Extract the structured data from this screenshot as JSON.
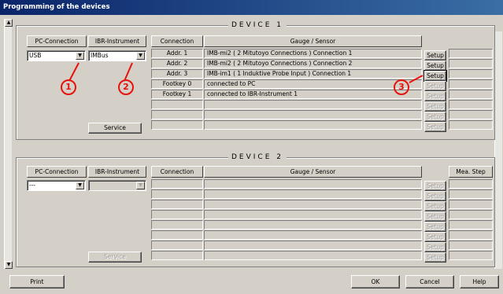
{
  "window": {
    "title": "Programming of the devices"
  },
  "device1": {
    "title": "DEVICE 1",
    "pc_connection_header": "PC-Connection",
    "ibr_instrument_header": "IBR-Instrument",
    "connection_header": "Connection",
    "gauge_header": "Gauge / Sensor",
    "pc_connection_value": "USB",
    "ibr_instrument_value": "IMBus",
    "service_label": "Service",
    "rows": [
      {
        "connection": "Addr. 1",
        "gauge": "IMB-mi2 ( 2 Mitutoyo Connections ) Connection 1",
        "setup": "Setup",
        "enabled": true
      },
      {
        "connection": "Addr. 2",
        "gauge": "IMB-mi2 ( 2 Mitutoyo Connections ) Connection 2",
        "setup": "Setup",
        "enabled": true
      },
      {
        "connection": "Addr. 3",
        "gauge": "IMB-im1 ( 1 Induktive Probe Input ) Connection 1",
        "setup": "Setup",
        "enabled": true
      },
      {
        "connection": "Footkey 0",
        "gauge": "connected to PC",
        "setup": "Setup",
        "enabled": false
      },
      {
        "connection": "Footkey 1",
        "gauge": "connected to IBR-Instrument 1",
        "setup": "Setup",
        "enabled": false
      },
      {
        "connection": "",
        "gauge": "",
        "setup": "Setup",
        "enabled": false
      },
      {
        "connection": "",
        "gauge": "",
        "setup": "Setup",
        "enabled": false
      },
      {
        "connection": "",
        "gauge": "",
        "setup": "Setup",
        "enabled": false
      }
    ]
  },
  "device2": {
    "title": "DEVICE 2",
    "pc_connection_header": "PC-Connection",
    "ibr_instrument_header": "IBR-Instrument",
    "connection_header": "Connection",
    "gauge_header": "Gauge / Sensor",
    "mea_step_header": "Mea. Step",
    "pc_connection_value": "---",
    "ibr_instrument_value": "",
    "service_label": "Service",
    "setup_label": "Setup"
  },
  "callouts": [
    "1",
    "2",
    "3"
  ],
  "footer": {
    "print_label": "Print",
    "ok_label": "OK",
    "cancel_label": "Cancel",
    "help_label": "Help"
  },
  "colors": {
    "callout": "#e8120c",
    "titlebar": "#0a246a",
    "face": "#d4d0c8"
  },
  "icons": {
    "scroll_up": "▲",
    "scroll_down": "▼",
    "dropdown": "▼"
  }
}
